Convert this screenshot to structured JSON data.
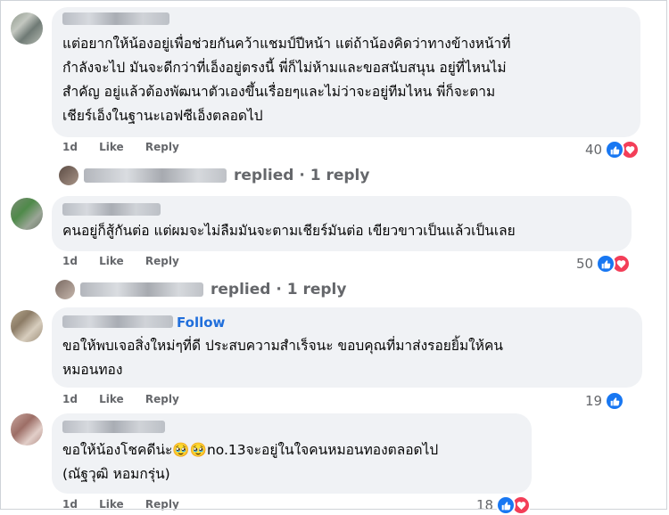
{
  "comments": [
    {
      "text_lines": [
        "แต่อยากให้น้องอยู่เพื่อช่วยกันคว้าแชมป์ปีหน้า แต่ถ้าน้องคิดว่าทางข้างหน้าที่",
        "กำลังจะไป มันจะดีกว่าที่เอ็งอยู่ตรงนี้ พี่ก็ไม่ห้ามและขอสนับสนุน อยู่ที่ไหนไม่",
        "สำคัญ อยู่แล้วต้องพัฒนาตัวเองขึ้นเรื่อยๆและไม่ว่าจะอยู่ทีมไหน พี่ก็จะตาม",
        "เชียร์เอ็งในฐานะเอฟซีเอ็งตลอดไป"
      ],
      "time": "1d",
      "like_label": "Like",
      "reply_label": "Reply",
      "reaction_count": "40",
      "reactions": [
        "like",
        "love"
      ],
      "replies_text": "replied · 1 reply"
    },
    {
      "text_lines": [
        "คนอยู่ก็สู้กันต่อ แต่ผมจะไม่ลืมมันจะตามเชียร์มันต่อ เขียวขาวเป็นแล้วเป็นเลย"
      ],
      "time": "1d",
      "like_label": "Like",
      "reply_label": "Reply",
      "reaction_count": "50",
      "reactions": [
        "like",
        "love"
      ],
      "replies_text": "replied · 1 reply"
    },
    {
      "follow_label": "Follow",
      "text_lines": [
        "ขอให้พบเจอสิ่งใหม่ๆที่ดี ประสบความสำเร็จนะ ขอบคุณที่มาส่งรอยยิ้มให้คน",
        "หมอนทอง"
      ],
      "time": "1d",
      "like_label": "Like",
      "reply_label": "Reply",
      "reaction_count": "19",
      "reactions": [
        "like"
      ]
    },
    {
      "text_lines": [
        "ขอให้น้องโชคดีน่ะ🥹🥹no.13จะอยู่ในใจคนหมอนทองตลอดไป",
        "(ณัฐวุฒิ หอมกรุ่น)"
      ],
      "time": "1d",
      "like_label": "Like",
      "reply_label": "Reply",
      "reaction_count": "18",
      "reactions": [
        "like",
        "love"
      ]
    }
  ],
  "colors": {
    "bubble": "#f0f2f5",
    "like": "#1877f2",
    "love": "#f33e58",
    "link": "#216fdb",
    "meta": "#65676b"
  },
  "icons": [
    "thumbs-up-icon",
    "heart-icon"
  ]
}
